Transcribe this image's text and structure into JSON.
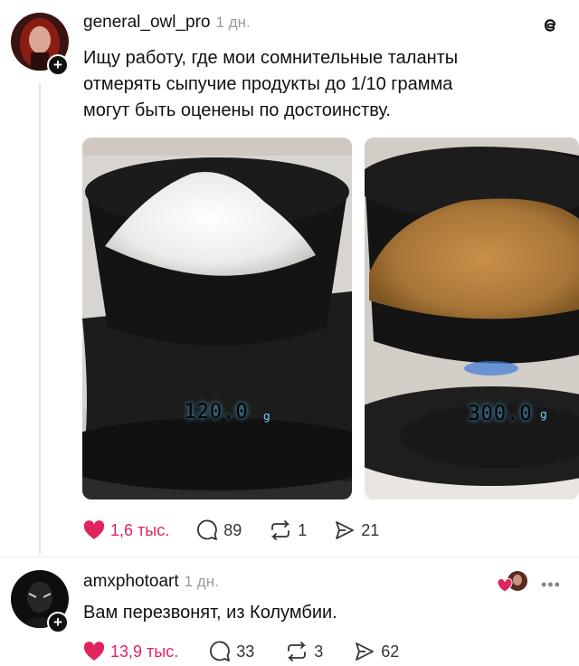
{
  "post": {
    "username": "general_owl_pro",
    "time": "1 дн.",
    "text_lines": [
      "Ищу работу, где мои сомнительные таланты",
      "отмерять сыпучие продукты до 1/10 грамма",
      "могут быть оценены по достоинству."
    ],
    "photos": [
      {
        "reading": "120.0",
        "unit": "g",
        "content": "white-powder"
      },
      {
        "reading": "300.0",
        "unit": "g",
        "content": "brown-sugar"
      }
    ],
    "likes": "1,6 тыс.",
    "comments": "89",
    "reposts": "1",
    "shares": "21"
  },
  "reply": {
    "username": "amxphotoart",
    "time": "1 дн.",
    "text": "Вам перезвонят, из Колумбии.",
    "likes": "13,9 тыс.",
    "comments": "33",
    "reposts": "3",
    "shares": "62"
  },
  "colors": {
    "like_red": "#e0245e",
    "text": "#111111",
    "muted": "#9a9a9a"
  }
}
